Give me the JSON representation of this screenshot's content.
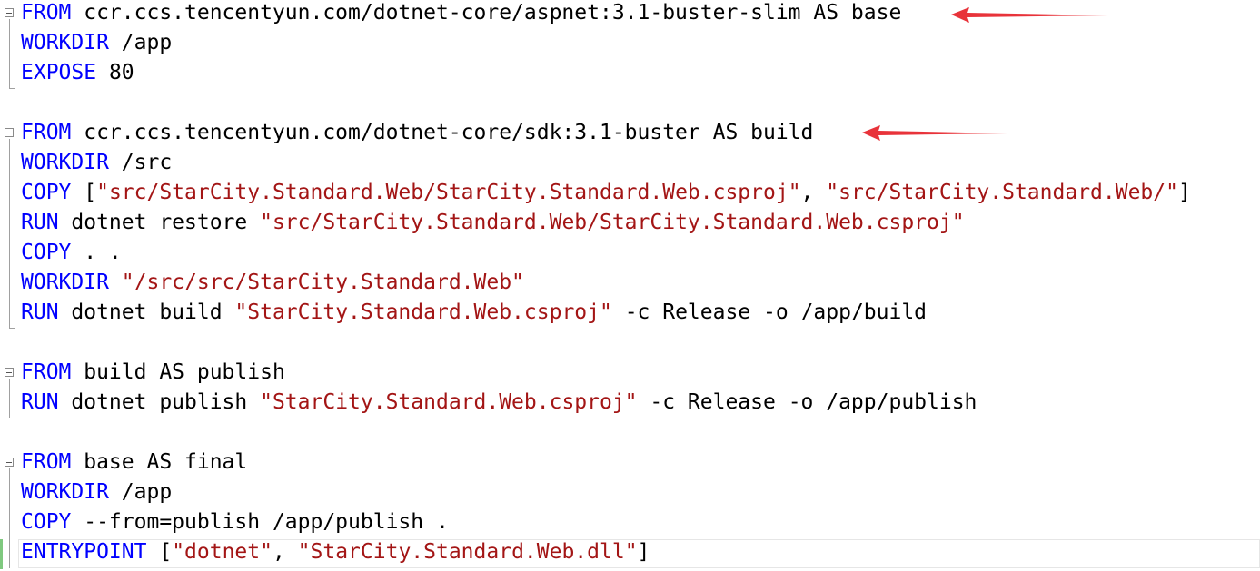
{
  "editor": {
    "accent_colors": {
      "keyword": "#0000ff",
      "string": "#a31515",
      "text": "#000000",
      "annotation_arrow": "#e8333a"
    },
    "lines": [
      {
        "folded_start": true,
        "tokens": [
          {
            "k": "kw",
            "t": "FROM"
          },
          {
            "k": "txt",
            "t": " ccr.ccs.tencentyun.com/dotnet-core/aspnet:3.1-buster-slim AS base"
          }
        ]
      },
      {
        "tokens": [
          {
            "k": "kw",
            "t": "WORKDIR"
          },
          {
            "k": "txt",
            "t": " /app"
          }
        ]
      },
      {
        "tokens": [
          {
            "k": "kw",
            "t": "EXPOSE"
          },
          {
            "k": "txt",
            "t": " 80"
          }
        ]
      },
      {
        "tokens": []
      },
      {
        "folded_start": true,
        "tokens": [
          {
            "k": "kw",
            "t": "FROM"
          },
          {
            "k": "txt",
            "t": " ccr.ccs.tencentyun.com/dotnet-core/sdk:3.1-buster AS build"
          }
        ]
      },
      {
        "tokens": [
          {
            "k": "kw",
            "t": "WORKDIR"
          },
          {
            "k": "txt",
            "t": " /src"
          }
        ]
      },
      {
        "tokens": [
          {
            "k": "kw",
            "t": "COPY"
          },
          {
            "k": "txt",
            "t": " ["
          },
          {
            "k": "str",
            "t": "\"src/StarCity.Standard.Web/StarCity.Standard.Web.csproj\""
          },
          {
            "k": "txt",
            "t": ", "
          },
          {
            "k": "str",
            "t": "\"src/StarCity.Standard.Web/\""
          },
          {
            "k": "txt",
            "t": "]"
          }
        ]
      },
      {
        "tokens": [
          {
            "k": "kw",
            "t": "RUN"
          },
          {
            "k": "txt",
            "t": " dotnet restore "
          },
          {
            "k": "str",
            "t": "\"src/StarCity.Standard.Web/StarCity.Standard.Web.csproj\""
          }
        ]
      },
      {
        "tokens": [
          {
            "k": "kw",
            "t": "COPY"
          },
          {
            "k": "txt",
            "t": " . ."
          }
        ]
      },
      {
        "tokens": [
          {
            "k": "kw",
            "t": "WORKDIR"
          },
          {
            "k": "txt",
            "t": " "
          },
          {
            "k": "str",
            "t": "\"/src/src/StarCity.Standard.Web\""
          }
        ]
      },
      {
        "tokens": [
          {
            "k": "kw",
            "t": "RUN"
          },
          {
            "k": "txt",
            "t": " dotnet build "
          },
          {
            "k": "str",
            "t": "\"StarCity.Standard.Web.csproj\""
          },
          {
            "k": "txt",
            "t": " -c Release -o /app/build"
          }
        ]
      },
      {
        "tokens": []
      },
      {
        "folded_start": true,
        "tokens": [
          {
            "k": "kw",
            "t": "FROM"
          },
          {
            "k": "txt",
            "t": " build AS publish"
          }
        ]
      },
      {
        "tokens": [
          {
            "k": "kw",
            "t": "RUN"
          },
          {
            "k": "txt",
            "t": " dotnet publish "
          },
          {
            "k": "str",
            "t": "\"StarCity.Standard.Web.csproj\""
          },
          {
            "k": "txt",
            "t": " -c Release -o /app/publish"
          }
        ]
      },
      {
        "tokens": []
      },
      {
        "folded_start": true,
        "tokens": [
          {
            "k": "kw",
            "t": "FROM"
          },
          {
            "k": "txt",
            "t": " base AS final"
          }
        ]
      },
      {
        "tokens": [
          {
            "k": "kw",
            "t": "WORKDIR"
          },
          {
            "k": "txt",
            "t": " /app"
          }
        ]
      },
      {
        "tokens": [
          {
            "k": "kw",
            "t": "COPY"
          },
          {
            "k": "txt",
            "t": " --from=publish /app/publish ."
          }
        ]
      },
      {
        "tokens": [
          {
            "k": "kw",
            "t": "ENTRYPOINT"
          },
          {
            "k": "txt",
            "t": " ["
          },
          {
            "k": "str",
            "t": "\"dotnet\""
          },
          {
            "k": "txt",
            "t": ", "
          },
          {
            "k": "str",
            "t": "\"StarCity.Standard.Web.dll\""
          },
          {
            "k": "txt",
            "t": "]"
          }
        ]
      }
    ]
  }
}
